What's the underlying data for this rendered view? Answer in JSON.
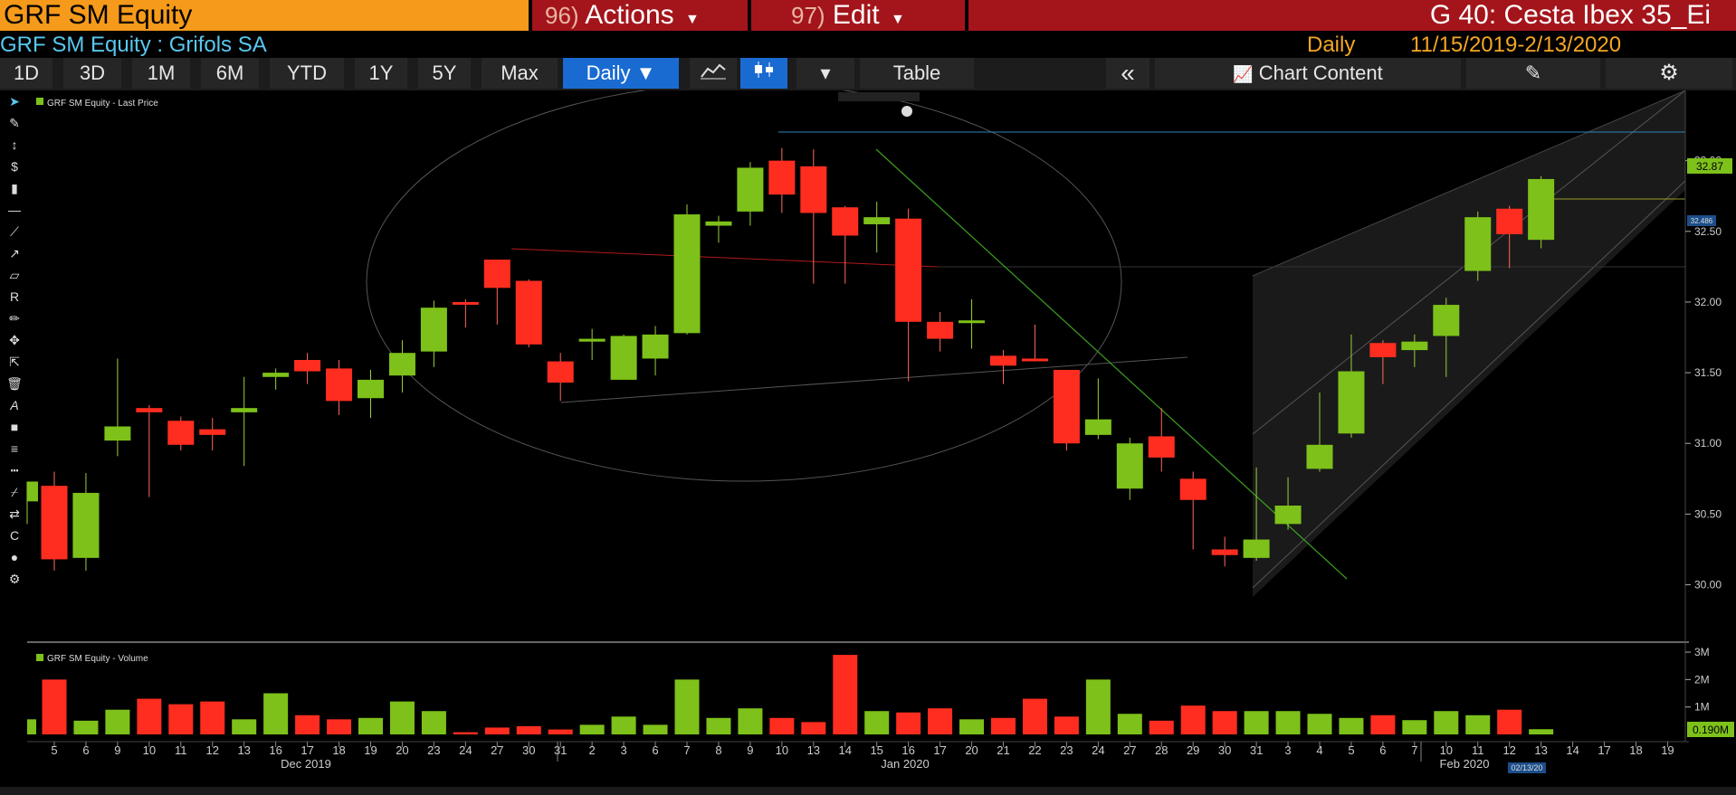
{
  "header": {
    "ticker": "GRF SM Equity",
    "actions_num": "96)",
    "actions_label": "Actions",
    "edit_num": "97)",
    "edit_label": "Edit",
    "page_title": "G 40: Cesta Ibex 35_Ei"
  },
  "subheader": {
    "security": "GRF SM Equity : Grifols SA",
    "period": "Daily",
    "date_range": "11/15/2019-2/13/2020"
  },
  "toolbar": {
    "ranges": [
      "1D",
      "3D",
      "1M",
      "6M",
      "YTD",
      "1Y",
      "5Y",
      "Max"
    ],
    "frequency": "Daily",
    "table_label": "Table",
    "collapse_icon": "double-chevron-left-icon",
    "chart_content_label": "Chart Content"
  },
  "legend": {
    "price": "GRF SM Equity - Last Price",
    "volume": "GRF SM Equity - Volume"
  },
  "price_tags": {
    "last": "32.87",
    "marker": "32.486"
  },
  "volume_tag": "0.190M",
  "cursor_date_tag": "02/13/20",
  "colors": {
    "up": "#7ec11a",
    "down": "#ff2d20",
    "accent": "#f59a1a",
    "brand_red": "#a3151b",
    "title_blue": "#58c8f0"
  },
  "chart_data": {
    "type": "candlestick",
    "price_axis": {
      "ticks": [
        "30.00",
        "30.50",
        "31.00",
        "31.50",
        "32.00",
        "32.50",
        "33.00"
      ],
      "ylim": [
        29.85,
        33.1
      ]
    },
    "volume_axis": {
      "ticks": [
        "1M",
        "2M",
        "3M"
      ]
    },
    "x_tick_labels": [
      "5",
      "6",
      "9",
      "10",
      "11",
      "12",
      "13",
      "16",
      "17",
      "18",
      "19",
      "20",
      "23",
      "24",
      "27",
      "30",
      "31",
      "2",
      "3",
      "6",
      "7",
      "8",
      "9",
      "10",
      "13",
      "14",
      "15",
      "16",
      "17",
      "20",
      "21",
      "22",
      "23",
      "24",
      "27",
      "28",
      "29",
      "30",
      "31",
      "3",
      "4",
      "5",
      "6",
      "7",
      "10",
      "11",
      "12",
      "13",
      "14",
      "17",
      "18",
      "19"
    ],
    "month_labels": [
      "Dec 2019",
      "Jan 2020",
      "Feb 2020"
    ],
    "candles": [
      {
        "o": 30.59,
        "h": 30.73,
        "l": 30.43,
        "c": 30.73
      },
      {
        "o": 30.7,
        "h": 30.8,
        "l": 30.1,
        "c": 30.18
      },
      {
        "o": 30.19,
        "h": 30.79,
        "l": 30.1,
        "c": 30.65
      },
      {
        "o": 31.02,
        "h": 31.6,
        "l": 30.91,
        "c": 31.12
      },
      {
        "o": 31.25,
        "h": 31.27,
        "l": 30.62,
        "c": 31.22
      },
      {
        "o": 31.16,
        "h": 31.19,
        "l": 30.95,
        "c": 30.99
      },
      {
        "o": 31.1,
        "h": 31.18,
        "l": 30.95,
        "c": 31.06
      },
      {
        "o": 31.22,
        "h": 31.47,
        "l": 30.84,
        "c": 31.25
      },
      {
        "o": 31.47,
        "h": 31.53,
        "l": 31.38,
        "c": 31.5
      },
      {
        "o": 31.59,
        "h": 31.64,
        "l": 31.42,
        "c": 31.51
      },
      {
        "o": 31.53,
        "h": 31.59,
        "l": 31.2,
        "c": 31.3
      },
      {
        "o": 31.32,
        "h": 31.52,
        "l": 31.18,
        "c": 31.45
      },
      {
        "o": 31.48,
        "h": 31.73,
        "l": 31.36,
        "c": 31.64
      },
      {
        "o": 31.65,
        "h": 32.01,
        "l": 31.54,
        "c": 31.96
      },
      {
        "o": 32.0,
        "h": 32.02,
        "l": 31.82,
        "c": 31.99
      },
      {
        "o": 32.3,
        "h": 32.3,
        "l": 31.84,
        "c": 32.1
      },
      {
        "o": 32.15,
        "h": 32.16,
        "l": 31.68,
        "c": 31.7
      },
      {
        "o": 31.58,
        "h": 31.64,
        "l": 31.3,
        "c": 31.43
      },
      {
        "o": 31.72,
        "h": 31.81,
        "l": 31.59,
        "c": 31.74
      },
      {
        "o": 31.45,
        "h": 31.77,
        "l": 31.45,
        "c": 31.76
      },
      {
        "o": 31.6,
        "h": 31.83,
        "l": 31.48,
        "c": 31.77
      },
      {
        "o": 31.78,
        "h": 32.69,
        "l": 31.77,
        "c": 32.62
      },
      {
        "o": 32.54,
        "h": 32.61,
        "l": 32.42,
        "c": 32.57
      },
      {
        "o": 32.64,
        "h": 32.99,
        "l": 32.54,
        "c": 32.95
      },
      {
        "o": 33.0,
        "h": 33.09,
        "l": 32.63,
        "c": 32.76
      },
      {
        "o": 32.96,
        "h": 33.08,
        "l": 32.13,
        "c": 32.63
      },
      {
        "o": 32.67,
        "h": 32.68,
        "l": 32.13,
        "c": 32.47
      },
      {
        "o": 32.55,
        "h": 32.71,
        "l": 32.35,
        "c": 32.6
      },
      {
        "o": 32.59,
        "h": 32.66,
        "l": 31.44,
        "c": 31.86
      },
      {
        "o": 31.86,
        "h": 31.93,
        "l": 31.65,
        "c": 31.74
      },
      {
        "o": 31.86,
        "h": 32.02,
        "l": 31.67,
        "c": 31.87
      },
      {
        "o": 31.62,
        "h": 31.66,
        "l": 31.42,
        "c": 31.55
      },
      {
        "o": 31.6,
        "h": 31.84,
        "l": 31.58,
        "c": 31.59
      },
      {
        "o": 31.52,
        "h": 31.52,
        "l": 30.95,
        "c": 31.0
      },
      {
        "o": 31.06,
        "h": 31.46,
        "l": 31.03,
        "c": 31.17
      },
      {
        "o": 30.68,
        "h": 31.04,
        "l": 30.6,
        "c": 31.0
      },
      {
        "o": 31.05,
        "h": 31.25,
        "l": 30.8,
        "c": 30.9
      },
      {
        "o": 30.75,
        "h": 30.8,
        "l": 30.25,
        "c": 30.6
      },
      {
        "o": 30.25,
        "h": 30.34,
        "l": 30.13,
        "c": 30.21
      },
      {
        "o": 30.19,
        "h": 30.83,
        "l": 30.17,
        "c": 30.32
      },
      {
        "o": 30.43,
        "h": 30.76,
        "l": 30.39,
        "c": 30.56
      },
      {
        "o": 30.82,
        "h": 31.36,
        "l": 30.8,
        "c": 30.99
      },
      {
        "o": 31.07,
        "h": 31.77,
        "l": 31.04,
        "c": 31.51
      },
      {
        "o": 31.71,
        "h": 31.73,
        "l": 31.42,
        "c": 31.61
      },
      {
        "o": 31.66,
        "h": 31.77,
        "l": 31.54,
        "c": 31.72
      },
      {
        "o": 31.76,
        "h": 32.03,
        "l": 31.47,
        "c": 31.98
      },
      {
        "o": 32.22,
        "h": 32.64,
        "l": 32.15,
        "c": 32.6
      },
      {
        "o": 32.66,
        "h": 32.68,
        "l": 32.24,
        "c": 32.48
      },
      {
        "o": 32.44,
        "h": 32.89,
        "l": 32.38,
        "c": 32.87
      }
    ],
    "volumes_m": [
      2.0,
      0.5,
      0.9,
      1.3,
      1.1,
      1.2,
      0.55,
      1.5,
      0.7,
      0.55,
      0.6,
      1.2,
      0.85,
      0.08,
      0.25,
      0.3,
      0.18,
      0.35,
      0.65,
      0.35,
      2.0,
      0.6,
      0.95,
      0.6,
      0.45,
      2.9,
      0.85,
      0.8,
      0.95,
      0.55,
      0.6,
      1.3,
      0.65,
      2.0,
      0.75,
      0.5,
      1.05,
      0.85,
      0.85,
      0.85,
      0.75,
      0.6,
      0.7,
      0.52,
      0.85,
      0.7,
      0.9,
      0.19
    ]
  }
}
